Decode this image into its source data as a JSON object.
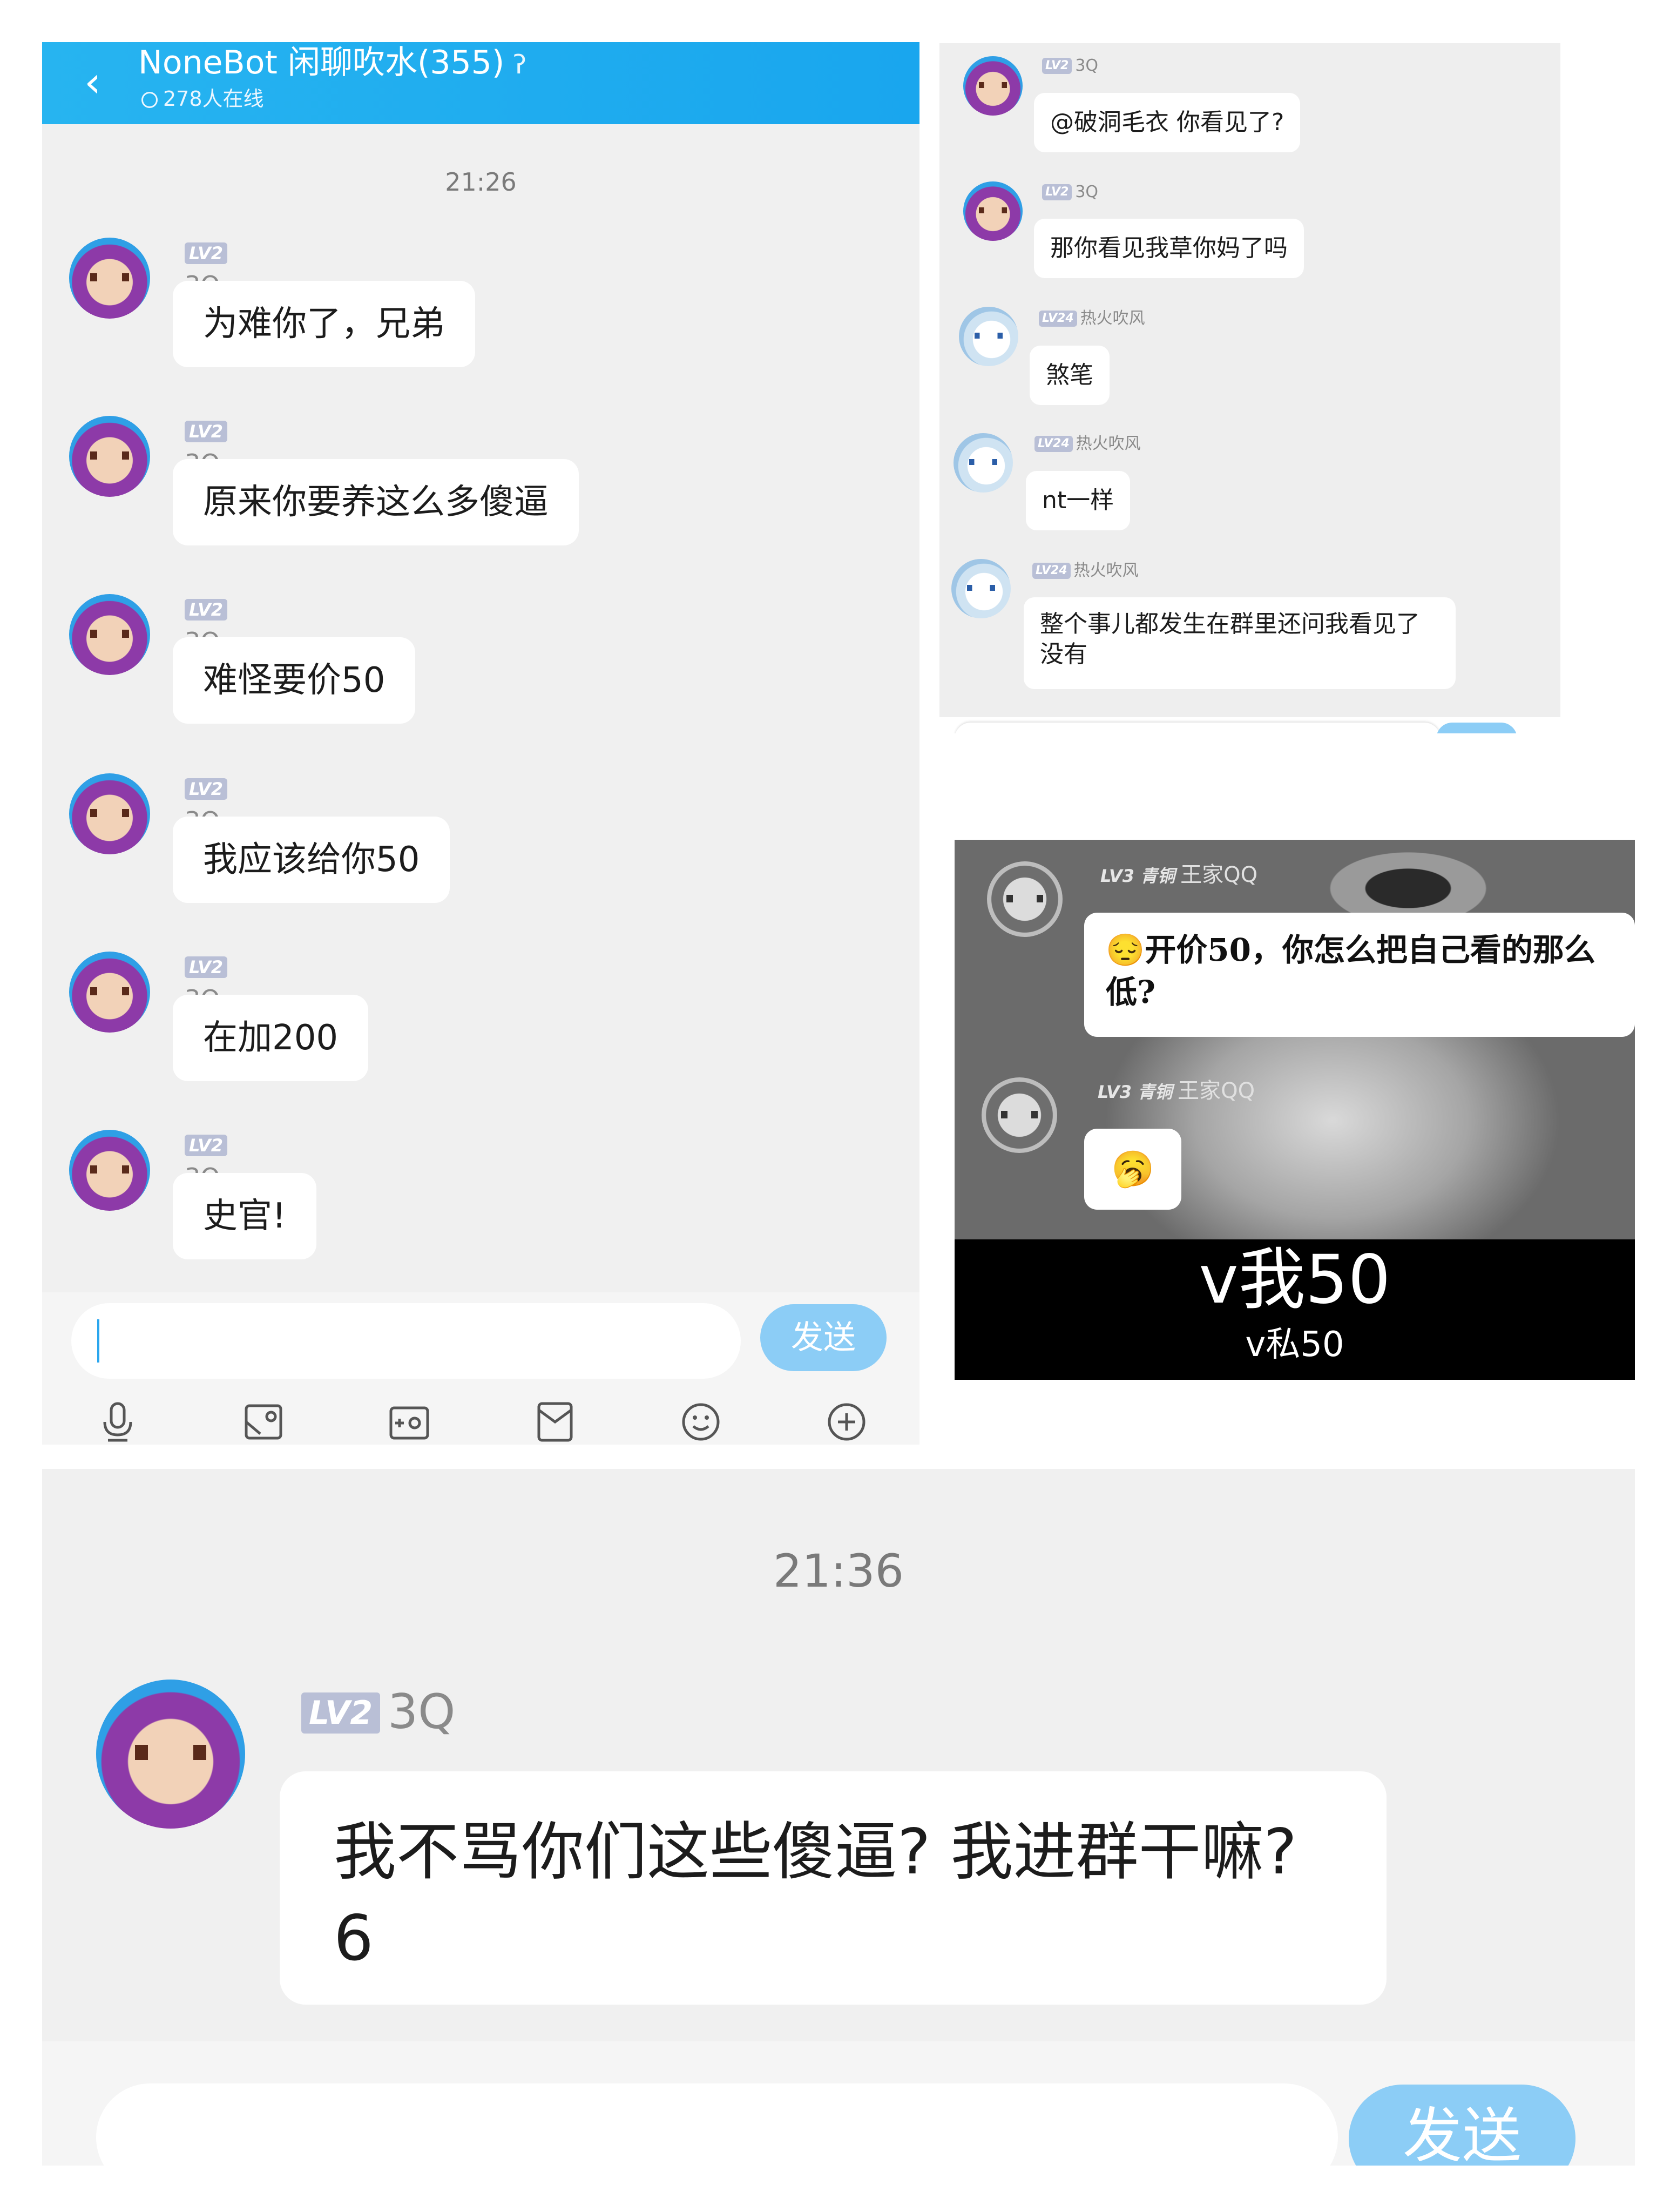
{
  "panel1": {
    "header": {
      "back_icon": "chevron-left-icon",
      "title": "NoneBot 闲聊吹水(355)",
      "ear_icon": "ear-icon",
      "online": "278人在线"
    },
    "time": "21:26",
    "messages": [
      {
        "level": "LV2",
        "name": "3Q",
        "text": "为难你了，兄弟"
      },
      {
        "level": "LV2",
        "name": "3Q",
        "text": "原来你要养这么多傻逼"
      },
      {
        "level": "LV2",
        "name": "3Q",
        "text": "难怪要价50"
      },
      {
        "level": "LV2",
        "name": "3Q",
        "text": "我应该给你50"
      },
      {
        "level": "LV2",
        "name": "3Q",
        "text": "在加200"
      },
      {
        "level": "LV2",
        "name": "3Q",
        "text": "史官!"
      }
    ],
    "input": {
      "placeholder": "",
      "send_label": "发送"
    },
    "toolbar_icons": [
      "microphone-icon",
      "image-icon",
      "camera-icon",
      "red-packet-icon",
      "emoji-icon",
      "plus-icon"
    ]
  },
  "panel2": {
    "messages": [
      {
        "level": "LV2",
        "name": "3Q",
        "text": "@破洞毛衣 你看见了?"
      },
      {
        "level": "LV2",
        "name": "3Q",
        "text": "那你看见我草你妈了吗"
      },
      {
        "level": "LV24",
        "name": "热火吹风",
        "text": "煞笔"
      },
      {
        "level": "LV24",
        "name": "热火吹风",
        "text": "nt一样"
      },
      {
        "level": "LV24",
        "name": "热火吹风",
        "text": "整个事儿都发生在群里还问我看见了没有"
      }
    ]
  },
  "panel3": {
    "messages": [
      {
        "level": "LV3 青铜",
        "name": "王家QQ",
        "text": "😔开价50，你怎么把自己看的那么低?"
      },
      {
        "level": "LV3 青铜",
        "name": "王家QQ",
        "text": "🥱"
      }
    ],
    "caption_main": "v我50",
    "caption_sub": "v私50"
  },
  "panel4": {
    "time": "21:36",
    "message": {
      "level": "LV2",
      "name": "3Q",
      "text": "我不骂你们这些傻逼? 我进群干嘛? 6"
    },
    "send_label": "发送"
  },
  "colors": {
    "header_blue": "#1ea9ef",
    "send_button": "#8ccdf6",
    "chat_bg": "#f0f0f0",
    "level_badge": "#b9bfd6"
  }
}
